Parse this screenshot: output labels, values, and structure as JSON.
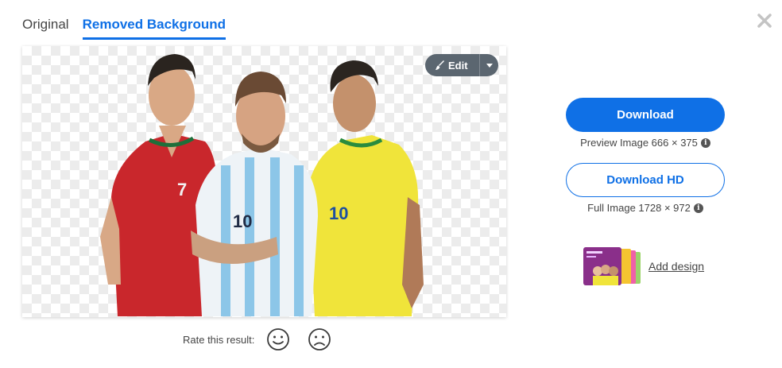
{
  "tabs": [
    {
      "label": "Original",
      "active": false
    },
    {
      "label": "Removed Background",
      "active": true
    }
  ],
  "toolbar": {
    "edit_label": "Edit"
  },
  "preview": {
    "image_subject": "three football players in national team jerseys on transparent background",
    "jersey_numbers": [
      "7",
      "10",
      "10"
    ]
  },
  "rating": {
    "label": "Rate this result:"
  },
  "download": {
    "label": "Download",
    "info": "Preview Image 666 × 375"
  },
  "download_hd": {
    "label": "Download HD",
    "info": "Full Image 1728 × 972"
  },
  "add_design": {
    "label": "Add design"
  },
  "colors": {
    "accent": "#0f70e6",
    "edit_button": "#5b6670",
    "text": "#454545",
    "close_icon": "#c4c4c4"
  },
  "icons": [
    "close-icon",
    "brush-icon",
    "chevron-down-icon",
    "smile-icon",
    "frown-icon",
    "info-icon"
  ]
}
